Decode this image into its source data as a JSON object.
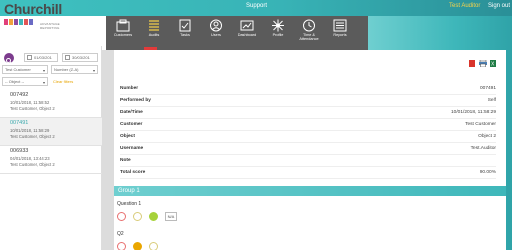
{
  "topbar": {
    "support": "Support",
    "user": "Test Auditor",
    "signout": "Sign out"
  },
  "logo": {
    "name": "Churchill",
    "tagline": "ADVANTAGE REPORTING"
  },
  "nav": {
    "items": [
      {
        "label": "Customers",
        "icon": "customers-icon"
      },
      {
        "label": "Audits",
        "icon": "audits-icon"
      },
      {
        "label": "Tasks",
        "icon": "tasks-icon"
      },
      {
        "label": "Users",
        "icon": "users-icon"
      },
      {
        "label": "Dashboard",
        "icon": "dashboard-icon"
      },
      {
        "label": "Profile",
        "icon": "profile-icon"
      },
      {
        "label": "Time &",
        "label2": "Attendance",
        "icon": "clock-icon"
      },
      {
        "label": "Reports",
        "icon": "reports-icon"
      }
    ],
    "active": "Audits"
  },
  "filters": {
    "date_from": "01/03/201",
    "date_to": "30/03/201",
    "customer_select": "Test Customer",
    "sort_select": "Number (Z-A)",
    "object_select": "-- Object --",
    "clear_filters": "Clear filters"
  },
  "audit_list": [
    {
      "number": "007492",
      "date": "10/01/2018, 11:58:52",
      "subtitle": "Test Customer, Object 2",
      "selected": false
    },
    {
      "number": "007491",
      "date": "10/01/2018, 11:58:29",
      "subtitle": "Test Customer, Object 2",
      "selected": true
    },
    {
      "number": "006933",
      "date": "04/01/2018, 13:44:23",
      "subtitle": "Test Customer, Object 2",
      "selected": false
    }
  ],
  "details": {
    "rows": [
      {
        "key": "Number",
        "value": "007491"
      },
      {
        "key": "Performed by",
        "value": "Self"
      },
      {
        "key": "Date/Time",
        "value": "10/01/2018, 11:58:29"
      },
      {
        "key": "Customer",
        "value": "Test Customer"
      },
      {
        "key": "Object",
        "value": "Object 2"
      },
      {
        "key": "Username",
        "value": "Test.Auditor"
      },
      {
        "key": "Note",
        "value": ""
      },
      {
        "key": "Total score",
        "value": "90.00%"
      }
    ]
  },
  "group": {
    "title": "Group 1"
  },
  "questions": [
    {
      "label": "Question 1",
      "na": "N/A"
    },
    {
      "label": "Q2"
    }
  ],
  "colors": {
    "teal": "#3eb7ba",
    "nav_bg": "#5b5b5b",
    "active_bar": "#e23a3a",
    "accent_purple": "#7c3b8d",
    "green": "#a6d23a",
    "orange": "#eaa600"
  }
}
